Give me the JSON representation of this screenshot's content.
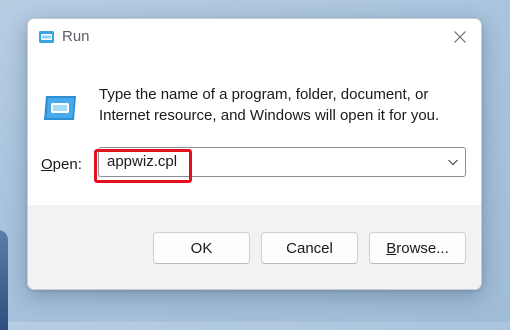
{
  "window": {
    "title": "Run",
    "icon": "run-icon",
    "close_icon": "close-icon"
  },
  "content": {
    "description": "Type the name of a program, folder, document, or Internet resource, and Windows will open it for you.",
    "open_label_accel": "O",
    "open_label_rest": "pen:",
    "open_value": "appwiz.cpl",
    "dropdown_icon": "chevron-down-icon",
    "highlight_color": "#e3101e"
  },
  "buttons": {
    "ok": "OK",
    "cancel": "Cancel",
    "browse_accel": "B",
    "browse_rest": "rowse..."
  }
}
